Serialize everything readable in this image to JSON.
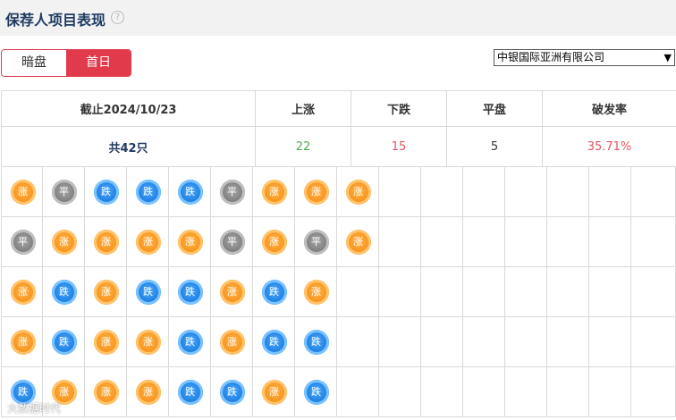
{
  "header": {
    "title": "保荐人项目表现",
    "help": "?"
  },
  "tabs": [
    {
      "label": "暗盘",
      "active": false
    },
    {
      "label": "首日",
      "active": true
    }
  ],
  "sponsor_select": {
    "value": "中银国际亚洲有限公司"
  },
  "summary": {
    "headers": [
      "截止2024/10/23",
      "上涨",
      "下跌",
      "平盘",
      "破发率"
    ],
    "total": "共42只",
    "rise": "22",
    "fall": "15",
    "flat": "5",
    "break_rate": "35.71%"
  },
  "colors": {
    "rise": "#4caf50",
    "fall": "#e05561",
    "flat": "#333333",
    "accent": "#e13a4b",
    "up_badge": "#f7941d",
    "down_badge": "#1e7fe0",
    "flat_badge": "#7d7d7d"
  },
  "badge_labels": {
    "up": "涨",
    "down": "跌",
    "flat": "平"
  },
  "grid_rows": [
    [
      "up",
      "flat",
      "down",
      "down",
      "down",
      "flat",
      "up",
      "up",
      "up"
    ],
    [
      "flat",
      "up",
      "up",
      "up",
      "up",
      "flat",
      "up",
      "flat",
      "up"
    ],
    [
      "up",
      "down",
      "up",
      "down",
      "down",
      "up",
      "down",
      "up"
    ],
    [
      "up",
      "down",
      "up",
      "up",
      "down",
      "up",
      "down",
      "down"
    ],
    [
      "down",
      "up",
      "up",
      "up",
      "down",
      "down",
      "up",
      "down"
    ]
  ],
  "watermark": "大数据时代"
}
